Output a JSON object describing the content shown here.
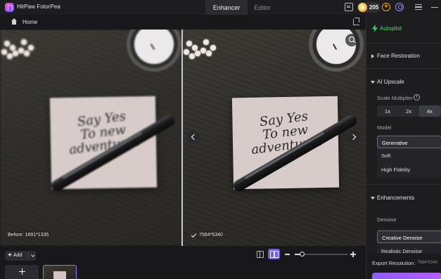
{
  "app": {
    "name": "HitPaw FotorPea"
  },
  "tabs": [
    {
      "label": "Enhancer",
      "active": true
    },
    {
      "label": "Editor",
      "active": false
    }
  ],
  "titlebar": {
    "credits": "205"
  },
  "breadcrumb": {
    "home_label": "Home"
  },
  "canvas": {
    "before_label": "Before: 1891*1335",
    "after_label": "7564*5340",
    "card_text": [
      "Say Yes",
      "To new",
      "adventures"
    ]
  },
  "bottombar": {
    "add_label": "Add",
    "zoom_level": 0.15
  },
  "panel": {
    "autopilot_label": "Autopilot",
    "face_restoration_label": "Face Restoration",
    "ai_upscale_label": "AI Upscale",
    "scale_multiplier_label": "Scale Multiplier",
    "scale_options": [
      "1x",
      "2x",
      "4x"
    ],
    "scale_selected": "4x",
    "model_label": "Model",
    "model_options": [
      "Generative",
      "Soft",
      "High Fidelity"
    ],
    "model_selected": "Generative",
    "enhancements_label": "Enhancements",
    "denoise_label": "Denoise",
    "denoise_options": [
      "Creative Denoise",
      "Realistic Denoise"
    ],
    "denoise_selected": "Creative Denoise",
    "export_label": "Export Resolution:",
    "export_value": "7564*5340"
  },
  "colors": {
    "accent": "#6f5cf0",
    "autopilot": "#54d86f",
    "credit": "#f0a31a"
  }
}
